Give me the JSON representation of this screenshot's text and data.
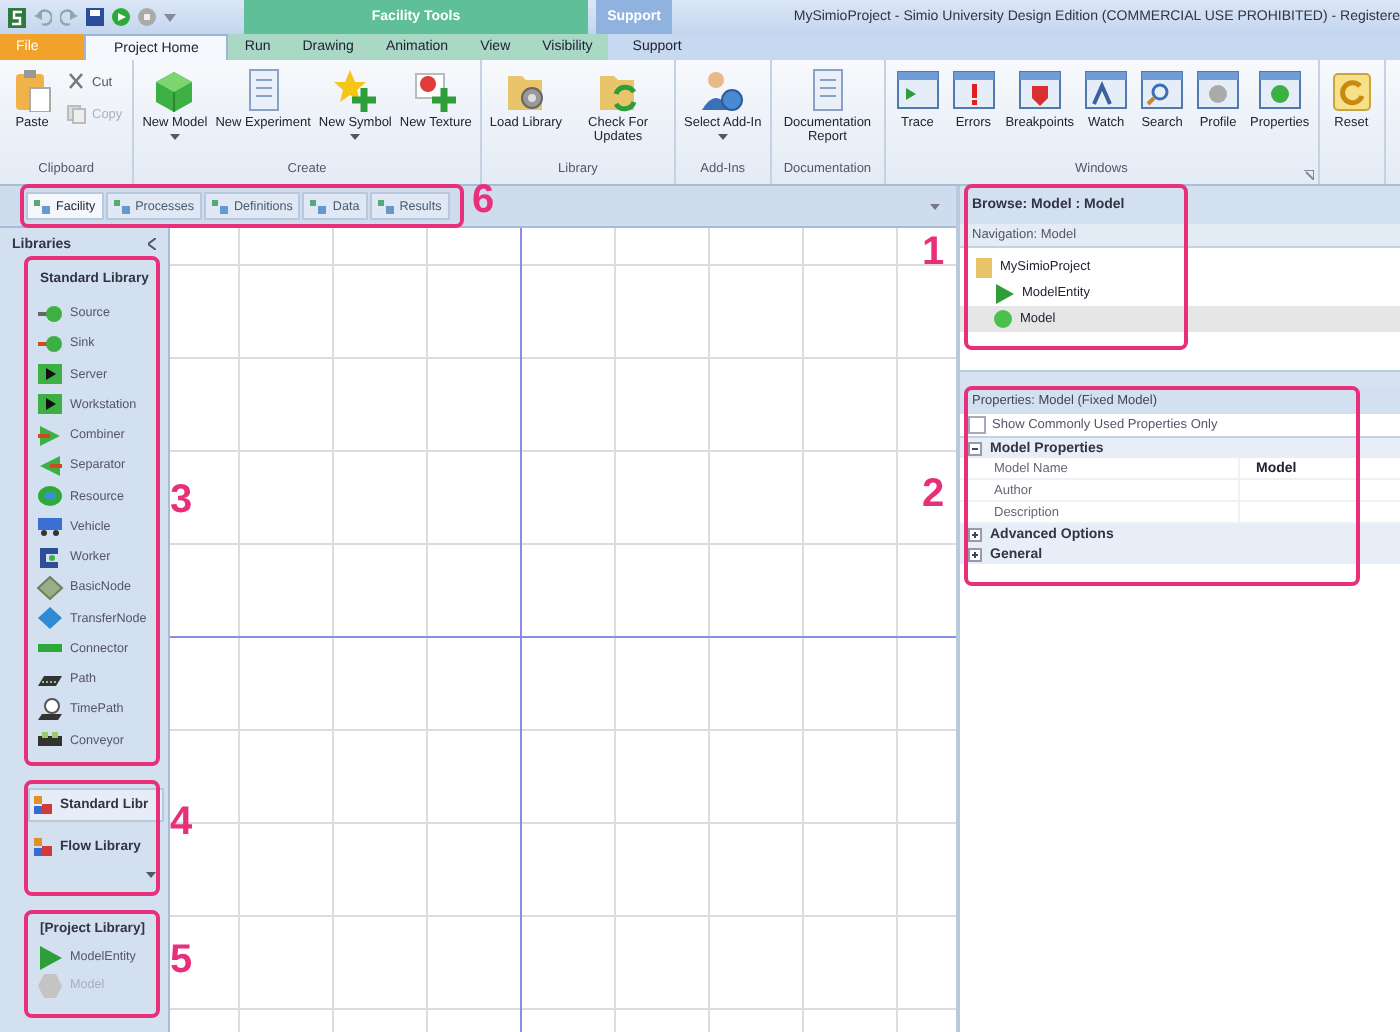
{
  "title_bar": {
    "title": "MySimioProject - Simio University Design Edition (COMMERCIAL USE PROHIBITED) - Registere",
    "contextual_tabs": [
      {
        "label": "Facility Tools",
        "kind": "tools"
      },
      {
        "label": "Support",
        "kind": "support"
      }
    ]
  },
  "ribbon_tabs": [
    {
      "label": "File",
      "kind": "file",
      "selected": false
    },
    {
      "label": "Project Home",
      "kind": "home",
      "selected": true
    },
    {
      "label": "Run",
      "kind": "tools",
      "selected": false
    },
    {
      "label": "Drawing",
      "kind": "tools",
      "selected": false
    },
    {
      "label": "Animation",
      "kind": "tools",
      "selected": false
    },
    {
      "label": "View",
      "kind": "tools",
      "selected": false
    },
    {
      "label": "Visibility",
      "kind": "tools",
      "selected": false
    },
    {
      "label": "Support",
      "kind": "support",
      "selected": false
    }
  ],
  "ribbon_groups": [
    {
      "label": "Clipboard",
      "launcher": false,
      "buttons": [
        {
          "label": "Paste",
          "kind": "large",
          "dropdown": false
        },
        {
          "label": "Cut",
          "kind": "small",
          "disabled": false
        },
        {
          "label": "Copy",
          "kind": "small",
          "disabled": true
        }
      ]
    },
    {
      "label": "Create",
      "launcher": false,
      "buttons": [
        {
          "label": "New Model",
          "kind": "large",
          "dropdown": true
        },
        {
          "label": "New Experiment",
          "kind": "large",
          "dropdown": false
        },
        {
          "label": "New Symbol",
          "kind": "large",
          "dropdown": true
        },
        {
          "label": "New Texture",
          "kind": "large",
          "dropdown": false
        }
      ]
    },
    {
      "label": "Library",
      "launcher": false,
      "buttons": [
        {
          "label": "Load Library",
          "kind": "large",
          "dropdown": false
        },
        {
          "label": "Check For Updates",
          "kind": "large",
          "dropdown": false
        }
      ]
    },
    {
      "label": "Add-Ins",
      "launcher": false,
      "buttons": [
        {
          "label": "Select Add-In",
          "kind": "large",
          "dropdown": true
        }
      ]
    },
    {
      "label": "Documentation",
      "launcher": false,
      "buttons": [
        {
          "label": "Documentation Report",
          "kind": "large",
          "dropdown": false
        }
      ]
    },
    {
      "label": "Windows",
      "launcher": true,
      "buttons": [
        {
          "label": "Trace",
          "kind": "large",
          "dropdown": false
        },
        {
          "label": "Errors",
          "kind": "large",
          "dropdown": false
        },
        {
          "label": "Breakpoints",
          "kind": "large",
          "dropdown": false
        },
        {
          "label": "Watch",
          "kind": "large",
          "dropdown": false
        },
        {
          "label": "Search",
          "kind": "large",
          "dropdown": false
        },
        {
          "label": "Profile",
          "kind": "large",
          "dropdown": false
        },
        {
          "label": "Properties",
          "kind": "large",
          "dropdown": false
        }
      ]
    },
    {
      "launcher": false,
      "buttons": [
        {
          "label": "Reset",
          "kind": "large",
          "dropdown": false
        }
      ]
    }
  ],
  "document_tabs": [
    {
      "label": "Facility",
      "selected": true
    },
    {
      "label": "Processes",
      "selected": false
    },
    {
      "label": "Definitions",
      "selected": false
    },
    {
      "label": "Data",
      "selected": false
    },
    {
      "label": "Results",
      "selected": false
    }
  ],
  "libraries": {
    "title": "Libraries",
    "standard": {
      "title": "Standard Library",
      "items": [
        "Source",
        "Sink",
        "Server",
        "Workstation",
        "Combiner",
        "Separator",
        "Resource",
        "Vehicle",
        "Worker",
        "BasicNode",
        "TransferNode",
        "Connector",
        "Path",
        "TimePath",
        "Conveyor"
      ]
    },
    "library_list": [
      {
        "label": "Standard Libr",
        "selected": true
      },
      {
        "label": "Flow Library",
        "selected": false
      }
    ],
    "project": {
      "title": "[Project Library]",
      "items": [
        {
          "label": "ModelEntity",
          "disabled": false
        },
        {
          "label": "Model",
          "disabled": true
        }
      ]
    }
  },
  "browse": {
    "title": "Browse: Model : Model",
    "navigation": "Navigation: Model",
    "tree": [
      {
        "label": "MySimioProject",
        "selected": false,
        "children": [
          {
            "label": "ModelEntity",
            "selected": false
          },
          {
            "label": "Model",
            "selected": true
          }
        ]
      }
    ]
  },
  "properties": {
    "title": "Properties: Model (Fixed Model)",
    "filter": {
      "label": "Show Commonly Used Properties Only",
      "checked": false
    },
    "categories": [
      {
        "label": "Model Properties",
        "expanded": true,
        "rows": [
          {
            "name": "Model Name",
            "value": "Model"
          },
          {
            "name": "Author"
          },
          {
            "name": "Description"
          }
        ]
      },
      {
        "label": "Advanced Options",
        "expanded": false
      },
      {
        "label": "General",
        "expanded": false
      }
    ]
  },
  "callouts": [
    {
      "number": "1"
    },
    {
      "number": "2"
    },
    {
      "number": "3"
    },
    {
      "number": "4"
    },
    {
      "number": "5"
    },
    {
      "number": "6"
    }
  ]
}
